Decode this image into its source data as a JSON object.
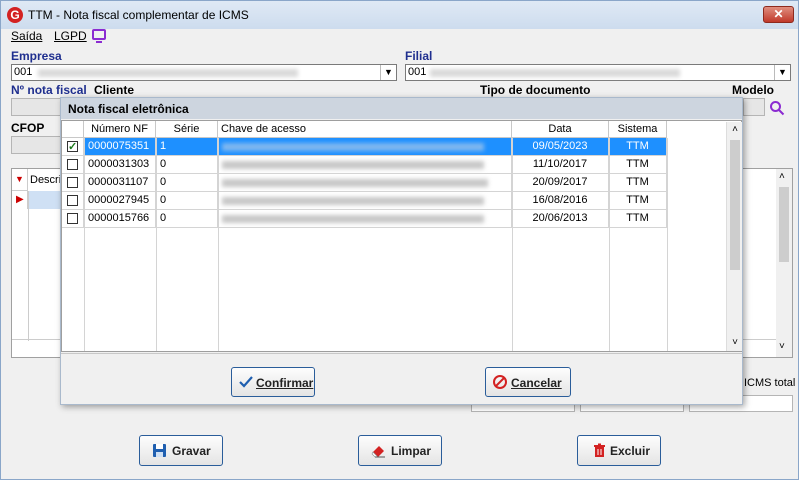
{
  "window": {
    "title": "TTM - Nota fiscal complementar de ICMS",
    "close_label": "✕"
  },
  "menu": {
    "items": [
      "Saída",
      "LGPD"
    ]
  },
  "form": {
    "empresa_label": "Empresa",
    "empresa_value": "001",
    "filial_label": "Filial",
    "filial_value": "001",
    "nota_label": "Nº nota fiscal",
    "cliente_label": "Cliente",
    "tipo_label": "Tipo de documento",
    "modelo_label": "Modelo",
    "cfop_label": "CFOP",
    "grid_descricao": "Descri",
    "icms_total_label": "ICMS total"
  },
  "buttons": {
    "gravar": "Gravar",
    "limpar": "Limpar",
    "excluir": "Excluir"
  },
  "modal": {
    "title": "Nota fiscal eletrônica",
    "columns": [
      "Número NF",
      "Série",
      "Chave de acesso",
      "Data",
      "Sistema"
    ],
    "rows": [
      {
        "checked": true,
        "numero": "0000075351",
        "serie": "1",
        "data": "09/05/2023",
        "sistema": "TTM"
      },
      {
        "checked": false,
        "numero": "0000031303",
        "serie": "0",
        "data": "11/10/2017",
        "sistema": "TTM"
      },
      {
        "checked": false,
        "numero": "0000031107",
        "serie": "0",
        "data": "20/09/2017",
        "sistema": "TTM"
      },
      {
        "checked": false,
        "numero": "0000027945",
        "serie": "0",
        "data": "16/08/2016",
        "sistema": "TTM"
      },
      {
        "checked": false,
        "numero": "0000015766",
        "serie": "0",
        "data": "20/06/2013",
        "sistema": "TTM"
      }
    ],
    "confirm_label": "Confirmar",
    "cancel_label": "Cancelar"
  },
  "colors": {
    "selection": "#1e90ff",
    "button_border": "#2a5d9a",
    "accent_purple": "#8b2bd1"
  }
}
